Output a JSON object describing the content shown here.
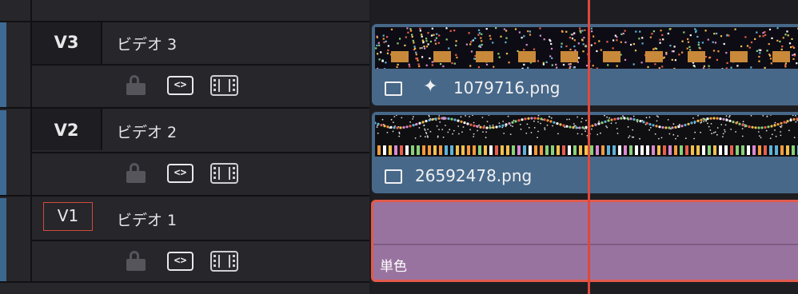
{
  "tracks": [
    {
      "id": "V3",
      "name": "ビデオ 3",
      "clip": {
        "filename": "1079716.png",
        "color": "#476889",
        "has_effect": true
      }
    },
    {
      "id": "V2",
      "name": "ビデオ 2",
      "clip": {
        "filename": "26592478.png",
        "color": "#476889",
        "has_effect": false
      }
    },
    {
      "id": "V1",
      "name": "ビデオ 1",
      "selected": true,
      "clip": {
        "label": "単色",
        "color": "#99739f"
      }
    }
  ],
  "icons": {
    "lock": "lock-icon",
    "auto_select": "auto-select-icon",
    "video_toggle": "film-icon",
    "image": "image-icon",
    "effect": "sparkle-icon"
  },
  "colors": {
    "playhead": "#e0483a",
    "selection": "#e25a4c",
    "track_strip": "#3e6a93"
  }
}
